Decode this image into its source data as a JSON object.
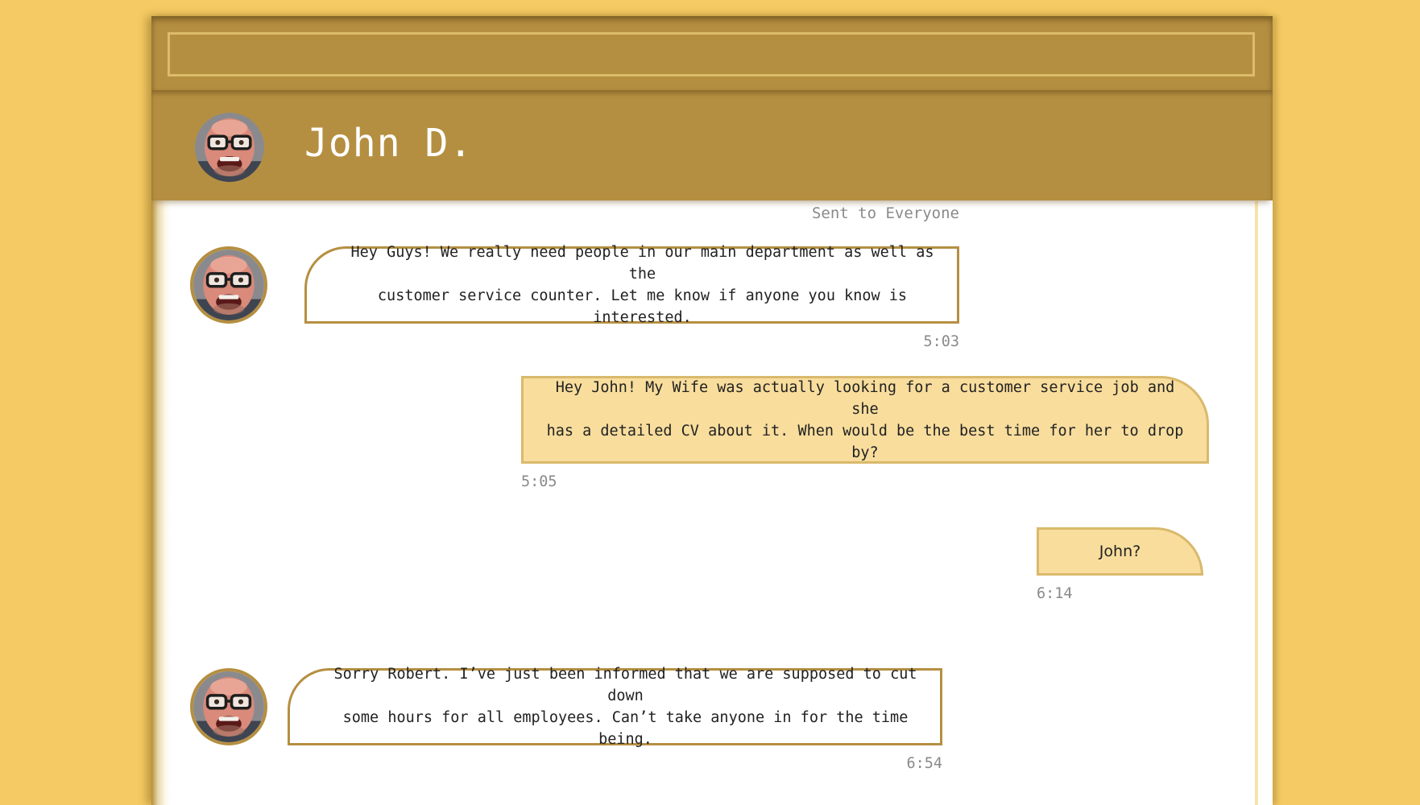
{
  "window": {
    "address_value": ""
  },
  "header": {
    "contact_name": "John D."
  },
  "chat": {
    "audience_label": "Sent to Everyone",
    "messages": [
      {
        "direction": "incoming",
        "text": "Hey Guys! We really need people in our main department as well as the\ncustomer service counter. Let me know if anyone you know is interested.",
        "time": "5:03"
      },
      {
        "direction": "outgoing",
        "text": "Hey John! My Wife was actually looking for a customer service job and she\nhas a detailed CV about it. When would be the best time for her to drop by?",
        "time": "5:05"
      },
      {
        "direction": "outgoing",
        "text": "John?",
        "time": "6:14"
      },
      {
        "direction": "incoming",
        "text": "Sorry Robert. I’ve just been informed that we are supposed to cut down\nsome hours for all employees. Can’t take anyone in for the time being.",
        "time": "6:54"
      }
    ]
  },
  "colors": {
    "background": "#f5ca64",
    "header": "#b58f41",
    "outgoing_bubble": "#f8dd9d",
    "incoming_border": "#b58f41"
  }
}
